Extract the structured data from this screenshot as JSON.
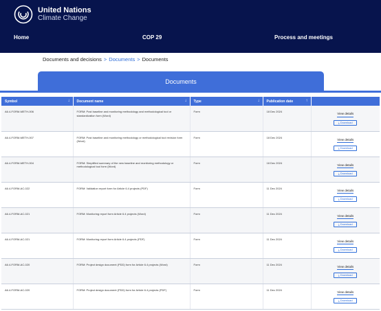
{
  "header": {
    "brand_line1": "United Nations",
    "brand_line2": "Climate Change",
    "nav": [
      "Home",
      "COP 29",
      "Process and meetings"
    ]
  },
  "breadcrumb": [
    "Documents and decisions",
    "Documents",
    "Documents"
  ],
  "breadcrumb_separator": ">",
  "tab_title": "Documents",
  "table": {
    "columns": [
      "Symbol",
      "Document name",
      "Type",
      "Publication date"
    ],
    "view_label": "View details",
    "download_label": "Download",
    "rows": [
      {
        "symbol": "A6.4-FORM-METH-006",
        "name": "FORM: Post baseline and monitoring methodology and methodological tool or standardization form (Word)",
        "type": "Form",
        "date": "18 Dec 2024"
      },
      {
        "symbol": "A6.4-FORM-METH-007",
        "name": "FORM: Post baseline and monitoring methodology or methodological tool revision form (Word)",
        "type": "Form",
        "date": "18 Dec 2024"
      },
      {
        "symbol": "A6.4-FORM-METH-004",
        "name": "FORM: Simplified summary of the new baseline and monitoring methodology or methodological tool form (Word)",
        "type": "Form",
        "date": "18 Dec 2024"
      },
      {
        "symbol": "A6.4-FORM-AC-022",
        "name": "FORM: Validation report form for Article 6.4 projects (PDF)",
        "type": "Form",
        "date": "11 Dec 2024"
      },
      {
        "symbol": "A6.4-FORM-AC-021",
        "name": "FORM: Monitoring report form Article 6.4 projects (Word)",
        "type": "Form",
        "date": "11 Dec 2024"
      },
      {
        "symbol": "A6.4-FORM-AC-021",
        "name": "FORM: Monitoring report form Article 6.4 projects (PDF)",
        "type": "Form",
        "date": "11 Dec 2024"
      },
      {
        "symbol": "A6.4-FORM-AC-020",
        "name": "FORM: Project design document (PDD) form for Article 6.4 projects (Word)",
        "type": "Form",
        "date": "11 Dec 2024"
      },
      {
        "symbol": "A6.4-FORM-AC-020",
        "name": "FORM: Project design document (PDD) form for Article 6.4 projects (PDF)",
        "type": "Form",
        "date": "11 Dec 2024"
      }
    ]
  },
  "colors": {
    "header_bg": "#07144d",
    "accent": "#3f6ed9",
    "link": "#2c6cd9"
  }
}
